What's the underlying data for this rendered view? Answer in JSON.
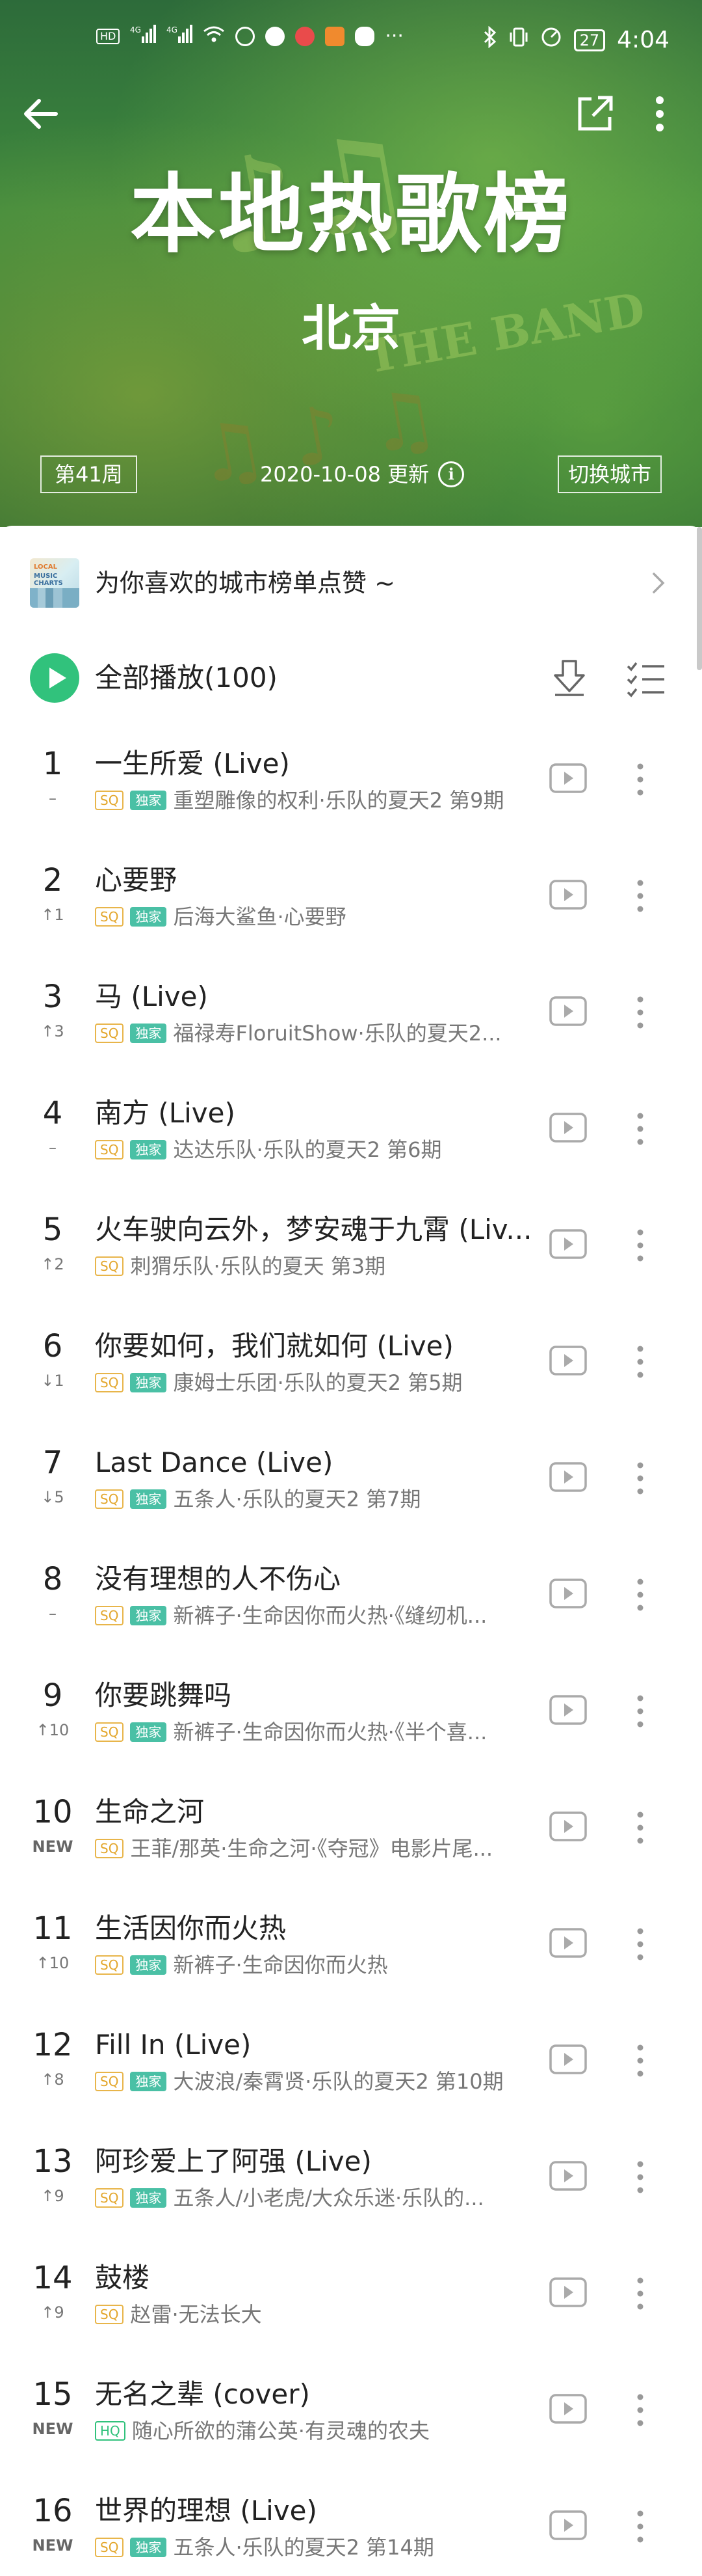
{
  "status_bar": {
    "left_items": [
      "HD",
      "4G",
      "4G"
    ],
    "time": "4:04",
    "battery": "27"
  },
  "header": {
    "title": "本地热歌榜",
    "city": "北京",
    "week_tag": "第41周",
    "update_text": "2020-10-08 更新",
    "switch_label": "切换城市",
    "accent_color": "#31c27c"
  },
  "promo": {
    "thumb_line1": "LOCAL",
    "thumb_line2": "MUSIC CHARTS",
    "text": "为你喜欢的城市榜单点赞 ~"
  },
  "playall": {
    "label": "全部播放(100)"
  },
  "songs": [
    {
      "rank": "1",
      "change": "–",
      "title": "一生所爱 (Live)",
      "quality": "SQ",
      "exclusive": true,
      "artist": "重塑雕像的权利·乐队的夏天2 第9期"
    },
    {
      "rank": "2",
      "change": "↑1",
      "title": "心要野",
      "quality": "SQ",
      "exclusive": true,
      "artist": "后海大鲨鱼·心要野"
    },
    {
      "rank": "3",
      "change": "↑3",
      "title": "马 (Live)",
      "quality": "SQ",
      "exclusive": true,
      "artist": "福禄寿FloruitShow·乐队的夏天2..."
    },
    {
      "rank": "4",
      "change": "–",
      "title": "南方 (Live)",
      "quality": "SQ",
      "exclusive": true,
      "artist": "达达乐队·乐队的夏天2 第6期"
    },
    {
      "rank": "5",
      "change": "↑2",
      "title": "火车驶向云外，梦安魂于九霄 (Liv...",
      "quality": "SQ",
      "exclusive": false,
      "artist": "刺猬乐队·乐队的夏天 第3期"
    },
    {
      "rank": "6",
      "change": "↓1",
      "title": "你要如何，我们就如何 (Live)",
      "quality": "SQ",
      "exclusive": true,
      "artist": "康姆士乐团·乐队的夏天2 第5期"
    },
    {
      "rank": "7",
      "change": "↓5",
      "title": "Last Dance (Live)",
      "quality": "SQ",
      "exclusive": true,
      "artist": "五条人·乐队的夏天2 第7期"
    },
    {
      "rank": "8",
      "change": "–",
      "title": "没有理想的人不伤心",
      "quality": "SQ",
      "exclusive": true,
      "artist": "新裤子·生命因你而火热·《缝纫机..."
    },
    {
      "rank": "9",
      "change": "↑10",
      "title": "你要跳舞吗",
      "quality": "SQ",
      "exclusive": true,
      "artist": "新裤子·生命因你而火热·《半个喜..."
    },
    {
      "rank": "10",
      "change": "NEW",
      "title": "生命之河",
      "quality": "SQ",
      "exclusive": false,
      "artist": "王菲/那英·生命之河·《夺冠》电影片尾..."
    },
    {
      "rank": "11",
      "change": "↑10",
      "title": "生活因你而火热",
      "quality": "SQ",
      "exclusive": true,
      "artist": "新裤子·生命因你而火热"
    },
    {
      "rank": "12",
      "change": "↑8",
      "title": "Fill In (Live)",
      "quality": "SQ",
      "exclusive": true,
      "artist": "大波浪/秦霄贤·乐队的夏天2 第10期"
    },
    {
      "rank": "13",
      "change": "↑9",
      "title": "阿珍爱上了阿强 (Live)",
      "quality": "SQ",
      "exclusive": true,
      "artist": "五条人/小老虎/大众乐迷·乐队的..."
    },
    {
      "rank": "14",
      "change": "↑9",
      "title": "鼓楼",
      "quality": "SQ",
      "exclusive": false,
      "artist": "赵雷·无法长大"
    },
    {
      "rank": "15",
      "change": "NEW",
      "title": "无名之辈 (cover)",
      "quality": "HQ",
      "exclusive": false,
      "artist": "随心所欲的蒲公英·有灵魂的农夫"
    },
    {
      "rank": "16",
      "change": "NEW",
      "title": "世界的理想 (Live)",
      "quality": "SQ",
      "exclusive": true,
      "artist": "五条人·乐队的夏天2 第14期"
    }
  ],
  "exclusive_label": "独家",
  "icons": {
    "back": "arrow-left-icon",
    "share": "share-icon",
    "more": "more-vertical-icon",
    "info": "info-icon",
    "play": "play-icon",
    "download": "download-icon",
    "multi_select": "multi-select-icon",
    "mv": "mv-play-icon"
  }
}
